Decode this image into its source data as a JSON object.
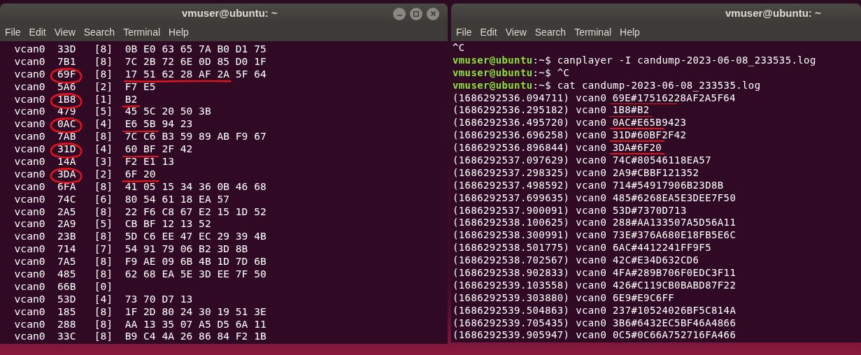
{
  "left_window": {
    "title": "vmuser@ubuntu: ~",
    "menu": [
      "File",
      "Edit",
      "View",
      "Search",
      "Terminal",
      "Help"
    ],
    "rows": [
      {
        "interface": "vcan0",
        "id": "33D",
        "dlc": "[8]",
        "circled": false,
        "data": "0B E0 63 65 7A B0 D1 75"
      },
      {
        "interface": "vcan0",
        "id": "7B1",
        "dlc": "[8]",
        "circled": false,
        "data": "7C 2B 72 6E 0D 85 D0 1F"
      },
      {
        "interface": "vcan0",
        "id": "69F",
        "dlc": "[8]",
        "circled": true,
        "data_underlined": "17 51 62 28 AF 2A",
        "data": "5F 64"
      },
      {
        "interface": "vcan0",
        "id": "5A6",
        "dlc": "[2]",
        "circled": false,
        "data": "F7 E5"
      },
      {
        "interface": "vcan0",
        "id": "1B8",
        "dlc": "[1]",
        "circled": true,
        "data_underlined": "B2"
      },
      {
        "interface": "vcan0",
        "id": "479",
        "dlc": "[5]",
        "circled": false,
        "data": "45 5C 20 50 3B"
      },
      {
        "interface": "vcan0",
        "id": "0AC",
        "dlc": "[4]",
        "circled": true,
        "data_underlined": "E6 5B",
        "data": "94 23"
      },
      {
        "interface": "vcan0",
        "id": "7AB",
        "dlc": "[8]",
        "circled": false,
        "data": "7C C6 B3 59 89 AB F9 67"
      },
      {
        "interface": "vcan0",
        "id": "31D",
        "dlc": "[4]",
        "circled": true,
        "data_underlined": "60 BF",
        "data": "2F 42"
      },
      {
        "interface": "vcan0",
        "id": "14A",
        "dlc": "[3]",
        "circled": false,
        "data": "F2 E1 13"
      },
      {
        "interface": "vcan0",
        "id": "3DA",
        "dlc": "[2]",
        "circled": true,
        "data_underlined": "6F 20"
      },
      {
        "interface": "vcan0",
        "id": "6FA",
        "dlc": "[8]",
        "circled": false,
        "data": "41 05 15 34 36 0B 46 68"
      },
      {
        "interface": "vcan0",
        "id": "74C",
        "dlc": "[6]",
        "circled": false,
        "data": "80 54 61 18 EA 57"
      },
      {
        "interface": "vcan0",
        "id": "2A5",
        "dlc": "[8]",
        "circled": false,
        "data": "22 F6 C8 67 E2 15 1D 52"
      },
      {
        "interface": "vcan0",
        "id": "2A9",
        "dlc": "[5]",
        "circled": false,
        "data": "CB BF 12 13 52"
      },
      {
        "interface": "vcan0",
        "id": "23B",
        "dlc": "[8]",
        "circled": false,
        "data": "5D C6 EE 47 EC 29 39 4B"
      },
      {
        "interface": "vcan0",
        "id": "714",
        "dlc": "[7]",
        "circled": false,
        "data": "54 91 79 06 B2 3D 8B"
      },
      {
        "interface": "vcan0",
        "id": "7A5",
        "dlc": "[8]",
        "circled": false,
        "data": "F9 AE 09 6B 4B 1D 7D 6B"
      },
      {
        "interface": "vcan0",
        "id": "485",
        "dlc": "[8]",
        "circled": false,
        "data": "62 68 EA 5E 3D EE 7F 50"
      },
      {
        "interface": "vcan0",
        "id": "66B",
        "dlc": "[0]",
        "circled": false
      },
      {
        "interface": "vcan0",
        "id": "53D",
        "dlc": "[4]",
        "circled": false,
        "data": "73 70 D7 13"
      },
      {
        "interface": "vcan0",
        "id": "185",
        "dlc": "[8]",
        "circled": false,
        "data": "1F 2D 80 24 30 19 51 3E"
      },
      {
        "interface": "vcan0",
        "id": "288",
        "dlc": "[8]",
        "circled": false,
        "data": "AA 13 35 07 A5 D5 6A 11"
      },
      {
        "interface": "vcan0",
        "id": "33C",
        "dlc": "[8]",
        "circled": false,
        "data": "B9 C4 4A 26 86 84 F2 1B"
      }
    ]
  },
  "right_window": {
    "title": "vmuser@ubuntu: ~",
    "menu": [
      "File",
      "Edit",
      "View",
      "Search",
      "Terminal",
      "Help"
    ],
    "lines": [
      {
        "kind": "plain",
        "text": "^C"
      },
      {
        "kind": "prompt",
        "prompt": "vmuser@ubuntu",
        "text": ":~$ canplayer -I candump-2023-06-08_233535.log"
      },
      {
        "kind": "prompt",
        "prompt": "vmuser@ubuntu",
        "text": ":~$ ^C"
      },
      {
        "kind": "prompt",
        "prompt": "vmuser@ubuntu",
        "text": ":~$ cat candump-2023-06-08_233535.log"
      },
      {
        "kind": "marked",
        "prefix": "(1686292536.094711) vcan0",
        "id": "69E",
        "sep": "#",
        "underlined": "175162",
        "rest": "28AF2A5F64"
      },
      {
        "kind": "marked",
        "prefix": "(1686292536.295182) vcan0",
        "id": "1B8",
        "sep": "#",
        "underlined": "B2"
      },
      {
        "kind": "marked",
        "prefix": "(1686292536.495720) vcan0",
        "id": "0AC",
        "sep": "#",
        "underlined": "E65B",
        "rest": "9423"
      },
      {
        "kind": "marked",
        "prefix": "(1686292536.696258) vcan0",
        "id": "31D",
        "sep": "#",
        "underlined": "60BF",
        "rest": "2F42"
      },
      {
        "kind": "marked",
        "prefix": "(1686292536.896844) vcan0",
        "id": "3DA",
        "sep": "#",
        "underlined": "6F20"
      },
      {
        "kind": "plain",
        "text": "(1686292537.097629) vcan0 74C#80546118EA57"
      },
      {
        "kind": "plain",
        "text": "(1686292537.298325) vcan0 2A9#CBBF121352"
      },
      {
        "kind": "plain",
        "text": "(1686292537.498592) vcan0 714#54917906B23D8B"
      },
      {
        "kind": "plain",
        "text": "(1686292537.699635) vcan0 485#6268EA5E3DEE7F50"
      },
      {
        "kind": "plain",
        "text": "(1686292537.900091) vcan0 53D#7370D713"
      },
      {
        "kind": "plain",
        "text": "(1686292538.100625) vcan0 288#AA133507A5D56A11"
      },
      {
        "kind": "plain",
        "text": "(1686292538.300991) vcan0 73E#376A680E18FB5E6C"
      },
      {
        "kind": "plain",
        "text": "(1686292538.501775) vcan0 6AC#4412241FF9F5"
      },
      {
        "kind": "plain",
        "text": "(1686292538.702567) vcan0 42C#E34D632CD6"
      },
      {
        "kind": "plain",
        "text": "(1686292538.902833) vcan0 4FA#289B706F0EDC3F11"
      },
      {
        "kind": "plain",
        "text": "(1686292539.103558) vcan0 426#C119CB0BABD87F22"
      },
      {
        "kind": "plain",
        "text": "(1686292539.303880) vcan0 6E9#E9C6FF"
      },
      {
        "kind": "plain",
        "text": "(1686292539.504863) vcan0 237#10524026BF5C814A"
      },
      {
        "kind": "plain",
        "text": "(1686292539.705435) vcan0 3B6#6432EC5BF46A4866"
      },
      {
        "kind": "plain",
        "text": "(1686292539.905947) vcan0 0C5#0C66A752716FA466"
      }
    ]
  }
}
